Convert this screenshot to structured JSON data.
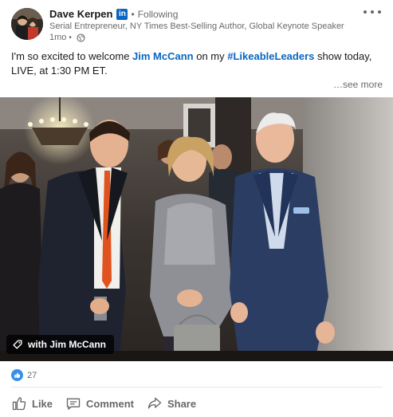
{
  "post": {
    "author": {
      "name": "Dave Kerpen",
      "badge_icon": "linkedin-icon",
      "badge_text": "in",
      "follow_status": "Following",
      "separator": "•",
      "headline": "Serial Entrepreneur, NY Times Best-Selling Author, Global Keynote Speaker",
      "time_ago": "1mo",
      "visibility_icon": "globe-icon"
    },
    "commentary": {
      "part1": "I'm so excited to welcome ",
      "mention": "Jim McCann",
      "part2": " on my ",
      "hashtag": "#LikeableLeaders",
      "part3": " show today, LIVE, at 1:30 PM ET."
    },
    "see_more": "…see more",
    "photo": {
      "tag_icon": "tag-icon",
      "tag_label": "with Jim McCann"
    },
    "social": {
      "reaction_icon": "like-reaction-icon",
      "reaction_count": "27"
    },
    "actions": [
      {
        "label": "Like",
        "icon": "thumbs-up-icon"
      },
      {
        "label": "Comment",
        "icon": "comment-icon"
      },
      {
        "label": "Share",
        "icon": "share-arrow-icon"
      }
    ],
    "colors": {
      "linkedin_blue": "#0a66c2",
      "reaction_blue": "#378fe9",
      "secondary_text": "#666666"
    }
  }
}
